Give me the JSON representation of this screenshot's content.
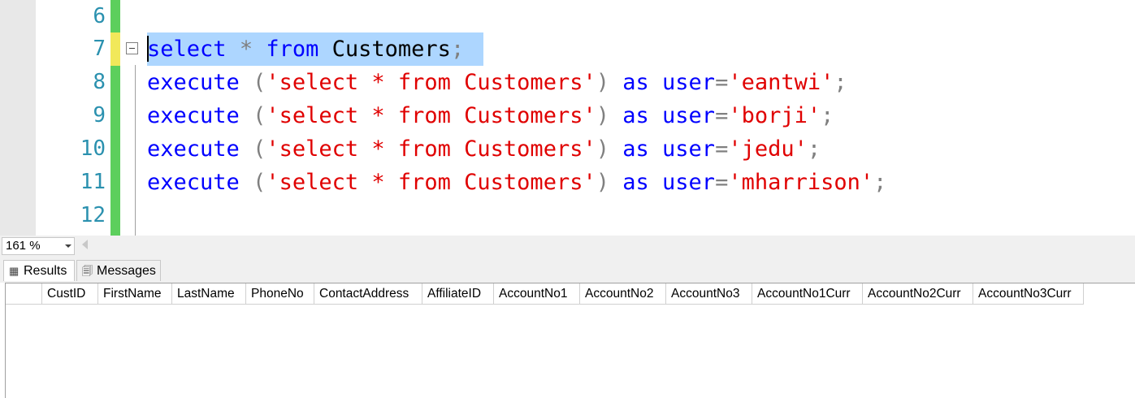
{
  "editor": {
    "lines": [
      {
        "number": "6",
        "tokens": []
      },
      {
        "number": "7",
        "tokens": [
          {
            "t": "select",
            "c": "kw"
          },
          {
            "t": " ",
            "c": "id"
          },
          {
            "t": "*",
            "c": "op"
          },
          {
            "t": " ",
            "c": "id"
          },
          {
            "t": "from",
            "c": "kw"
          },
          {
            "t": " Customers",
            "c": "id"
          },
          {
            "t": ";",
            "c": "op"
          }
        ]
      },
      {
        "number": "8",
        "tokens": [
          {
            "t": "execute",
            "c": "kw"
          },
          {
            "t": " ",
            "c": "id"
          },
          {
            "t": "(",
            "c": "op"
          },
          {
            "t": "'select * from Customers'",
            "c": "str"
          },
          {
            "t": ")",
            "c": "op"
          },
          {
            "t": " ",
            "c": "id"
          },
          {
            "t": "as",
            "c": "kw"
          },
          {
            "t": " ",
            "c": "id"
          },
          {
            "t": "user",
            "c": "kw"
          },
          {
            "t": "=",
            "c": "op"
          },
          {
            "t": "'eantwi'",
            "c": "str"
          },
          {
            "t": ";",
            "c": "op"
          }
        ]
      },
      {
        "number": "9",
        "tokens": [
          {
            "t": "execute",
            "c": "kw"
          },
          {
            "t": " ",
            "c": "id"
          },
          {
            "t": "(",
            "c": "op"
          },
          {
            "t": "'select * from Customers'",
            "c": "str"
          },
          {
            "t": ")",
            "c": "op"
          },
          {
            "t": " ",
            "c": "id"
          },
          {
            "t": "as",
            "c": "kw"
          },
          {
            "t": " ",
            "c": "id"
          },
          {
            "t": "user",
            "c": "kw"
          },
          {
            "t": "=",
            "c": "op"
          },
          {
            "t": "'borji'",
            "c": "str"
          },
          {
            "t": ";",
            "c": "op"
          }
        ]
      },
      {
        "number": "10",
        "tokens": [
          {
            "t": "execute",
            "c": "kw"
          },
          {
            "t": " ",
            "c": "id"
          },
          {
            "t": "(",
            "c": "op"
          },
          {
            "t": "'select * from Customers'",
            "c": "str"
          },
          {
            "t": ")",
            "c": "op"
          },
          {
            "t": " ",
            "c": "id"
          },
          {
            "t": "as",
            "c": "kw"
          },
          {
            "t": " ",
            "c": "id"
          },
          {
            "t": "user",
            "c": "kw"
          },
          {
            "t": "=",
            "c": "op"
          },
          {
            "t": "'jedu'",
            "c": "str"
          },
          {
            "t": ";",
            "c": "op"
          }
        ]
      },
      {
        "number": "11",
        "tokens": [
          {
            "t": "execute",
            "c": "kw"
          },
          {
            "t": " ",
            "c": "id"
          },
          {
            "t": "(",
            "c": "op"
          },
          {
            "t": "'select * from Customers'",
            "c": "str"
          },
          {
            "t": ")",
            "c": "op"
          },
          {
            "t": " ",
            "c": "id"
          },
          {
            "t": "as",
            "c": "kw"
          },
          {
            "t": " ",
            "c": "id"
          },
          {
            "t": "user",
            "c": "kw"
          },
          {
            "t": "=",
            "c": "op"
          },
          {
            "t": "'mharrison'",
            "c": "str"
          },
          {
            "t": ";",
            "c": "op"
          }
        ]
      },
      {
        "number": "12",
        "tokens": []
      }
    ],
    "colors": {
      "keyword": "#0000ff",
      "string": "#e00000",
      "operator": "#808080",
      "line_number": "#2b91af",
      "selection": "#add6ff",
      "change_saved": "#5ccf5c",
      "change_unsaved": "#f1e85a"
    }
  },
  "status": {
    "zoom": "161 %"
  },
  "results": {
    "tabs": [
      {
        "label": "Results",
        "icon": "grid-icon",
        "active": true
      },
      {
        "label": "Messages",
        "icon": "messages-icon",
        "active": false
      }
    ],
    "columns": [
      "CustID",
      "FirstName",
      "LastName",
      "PhoneNo",
      "ContactAddress",
      "AffiliateID",
      "AccountNo1",
      "AccountNo2",
      "AccountNo3",
      "AccountNo1Curr",
      "AccountNo2Curr",
      "AccountNo3Curr"
    ]
  }
}
